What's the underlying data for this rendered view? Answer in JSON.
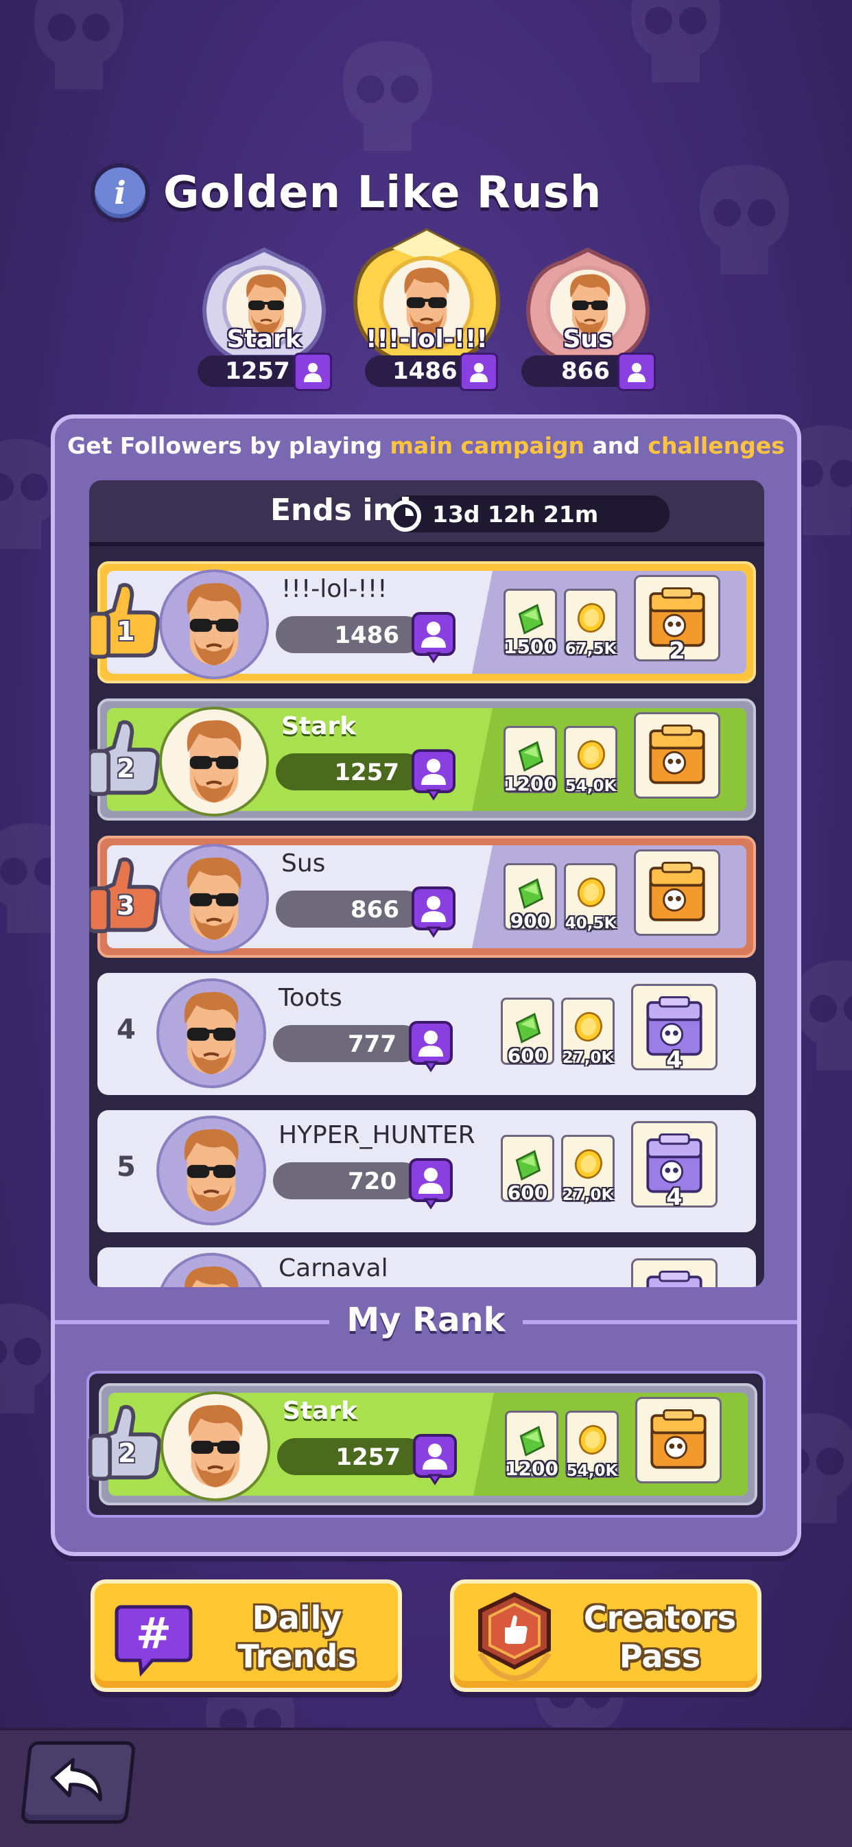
{
  "event": {
    "title": "Golden Like Rush",
    "subtitle_parts": [
      "Get Followers by playing ",
      "main campaign",
      " and ",
      "challenges"
    ],
    "ends_label": "Ends in",
    "timer": "13d 12h 21m"
  },
  "podium": [
    {
      "place": 2,
      "name": "Stark",
      "score": "1257"
    },
    {
      "place": 1,
      "name": "!!!-lol-!!!",
      "score": "1486"
    },
    {
      "place": 3,
      "name": "Sus",
      "score": "866"
    }
  ],
  "leaderboard": [
    {
      "rank": "1",
      "name": "!!!-lol-!!!",
      "score": "1486",
      "gems": "1500",
      "coins": "67,5K",
      "chest_count": "2",
      "chest": "orange-chest-icon"
    },
    {
      "rank": "2",
      "name": "Stark",
      "score": "1257",
      "gems": "1200",
      "coins": "54,0K",
      "chest_count": "",
      "chest": "orange-chest-icon"
    },
    {
      "rank": "3",
      "name": "Sus",
      "score": "866",
      "gems": "900",
      "coins": "40,5K",
      "chest_count": "",
      "chest": "orange-chest-icon"
    },
    {
      "rank": "4",
      "name": "Toots",
      "score": "777",
      "gems": "600",
      "coins": "27,0K",
      "chest_count": "4",
      "chest": "purple-chest-icon"
    },
    {
      "rank": "5",
      "name": "HYPER_HUNTER",
      "score": "720",
      "gems": "600",
      "coins": "27,0K",
      "chest_count": "4",
      "chest": "purple-chest-icon"
    },
    {
      "rank": "",
      "name": "Carnaval",
      "score": "",
      "gems": "",
      "coins": "",
      "chest_count": "",
      "chest": "purple-chest-icon"
    }
  ],
  "my_rank": {
    "label": "My Rank",
    "rank": "2",
    "name": "Stark",
    "score": "1257",
    "gems": "1200",
    "coins": "54,0K"
  },
  "buttons": {
    "daily_trends_line1": "Daily",
    "daily_trends_line2": "Trends",
    "creators_pass_line1": "Creators",
    "creators_pass_line2": "Pass"
  },
  "colors": {
    "gold_row": "#e9e8f7",
    "green_row": "#a8e04f",
    "follower": "#8a3fe0",
    "highlight": "#ffc43d"
  }
}
